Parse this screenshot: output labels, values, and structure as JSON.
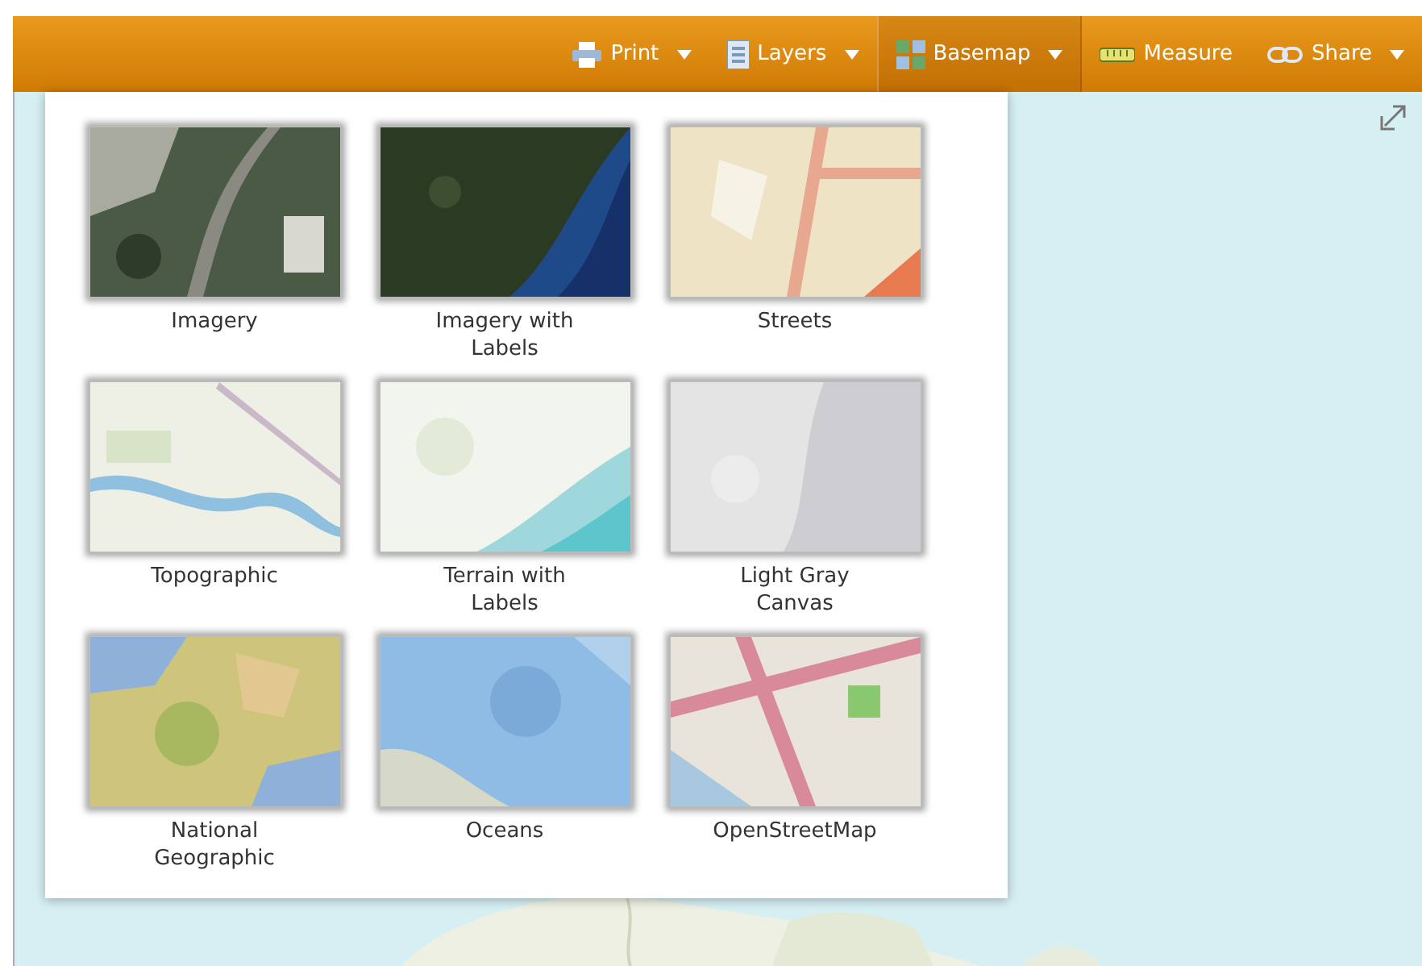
{
  "toolbar": {
    "items": [
      {
        "kind": "print",
        "label": "Print",
        "has_menu": true,
        "selected": false
      },
      {
        "kind": "layers",
        "label": "Layers",
        "has_menu": true,
        "selected": false
      },
      {
        "kind": "basemap",
        "label": "Basemap",
        "has_menu": true,
        "selected": true
      },
      {
        "kind": "measure",
        "label": "Measure",
        "has_menu": false,
        "selected": false
      },
      {
        "kind": "share",
        "label": "Share",
        "has_menu": true,
        "selected": false
      }
    ]
  },
  "basemap_gallery": {
    "items": [
      {
        "label": "Imagery"
      },
      {
        "label": "Imagery with Labels"
      },
      {
        "label": "Streets"
      },
      {
        "label": "Topographic"
      },
      {
        "label": "Terrain with Labels"
      },
      {
        "label": "Light Gray Canvas"
      },
      {
        "label": "National Geographic"
      },
      {
        "label": "Oceans"
      },
      {
        "label": "OpenStreetMap"
      }
    ]
  }
}
